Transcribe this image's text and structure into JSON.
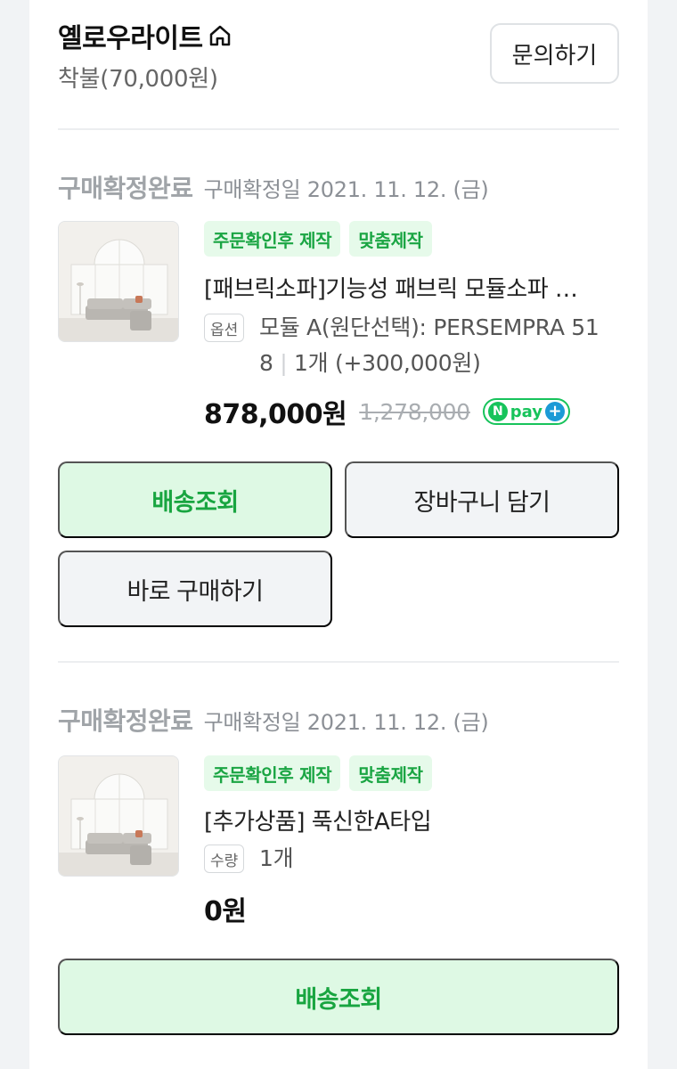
{
  "store": {
    "name": "옐로우라이트",
    "shipping": "착불(70,000원)",
    "inquiry_label": "문의하기"
  },
  "orders": [
    {
      "status": "구매확정완료",
      "date": "구매확정일 2021. 11. 12. (금)",
      "badges": [
        "주문확인후 제작",
        "맞춤제작"
      ],
      "title": "[패브릭소파]기능성 패브릭 모듈소파 …",
      "option_tag": "옵션",
      "option_line1": "모듈 A(원단선택): PERSEMPRA 51",
      "option_line2_a": "8",
      "option_sep": "|",
      "option_line2_b": "1개 (+300,000원)",
      "price": "878,000원",
      "original_price": "1,278,000",
      "npay": {
        "n": "N",
        "text": "pay",
        "plus": "+"
      },
      "buttons": {
        "track": "배송조회",
        "cart": "장바구니 담기",
        "buy_now": "바로 구매하기"
      }
    },
    {
      "status": "구매확정완료",
      "date": "구매확정일 2021. 11. 12. (금)",
      "badges": [
        "주문확인후 제작",
        "맞춤제작"
      ],
      "title": "[추가상품] 푹신한A타입",
      "option_tag": "수량",
      "option_line1": "1개",
      "price": "0원",
      "buttons": {
        "track": "배송조회"
      }
    }
  ],
  "colors": {
    "accent_green": "#18a540",
    "green_bg": "#def9e4",
    "npay_green": "#17c35b"
  }
}
